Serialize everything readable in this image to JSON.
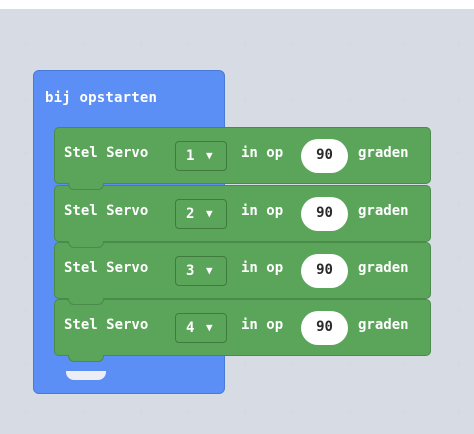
{
  "event_block": {
    "label": "bij opstarten",
    "color": "#5b8ff5"
  },
  "statement_color": "#5ba55b",
  "statements": [
    {
      "prefix": "Stel Servo",
      "servo": "1",
      "mid": "in op",
      "value": "90",
      "suffix": "graden"
    },
    {
      "prefix": "Stel Servo",
      "servo": "2",
      "mid": "in op",
      "value": "90",
      "suffix": "graden"
    },
    {
      "prefix": "Stel Servo",
      "servo": "3",
      "mid": "in op",
      "value": "90",
      "suffix": "graden"
    },
    {
      "prefix": "Stel Servo",
      "servo": "4",
      "mid": "in op",
      "value": "90",
      "suffix": "graden"
    }
  ],
  "icons": {
    "dropdown_caret": "caret-down-icon"
  }
}
